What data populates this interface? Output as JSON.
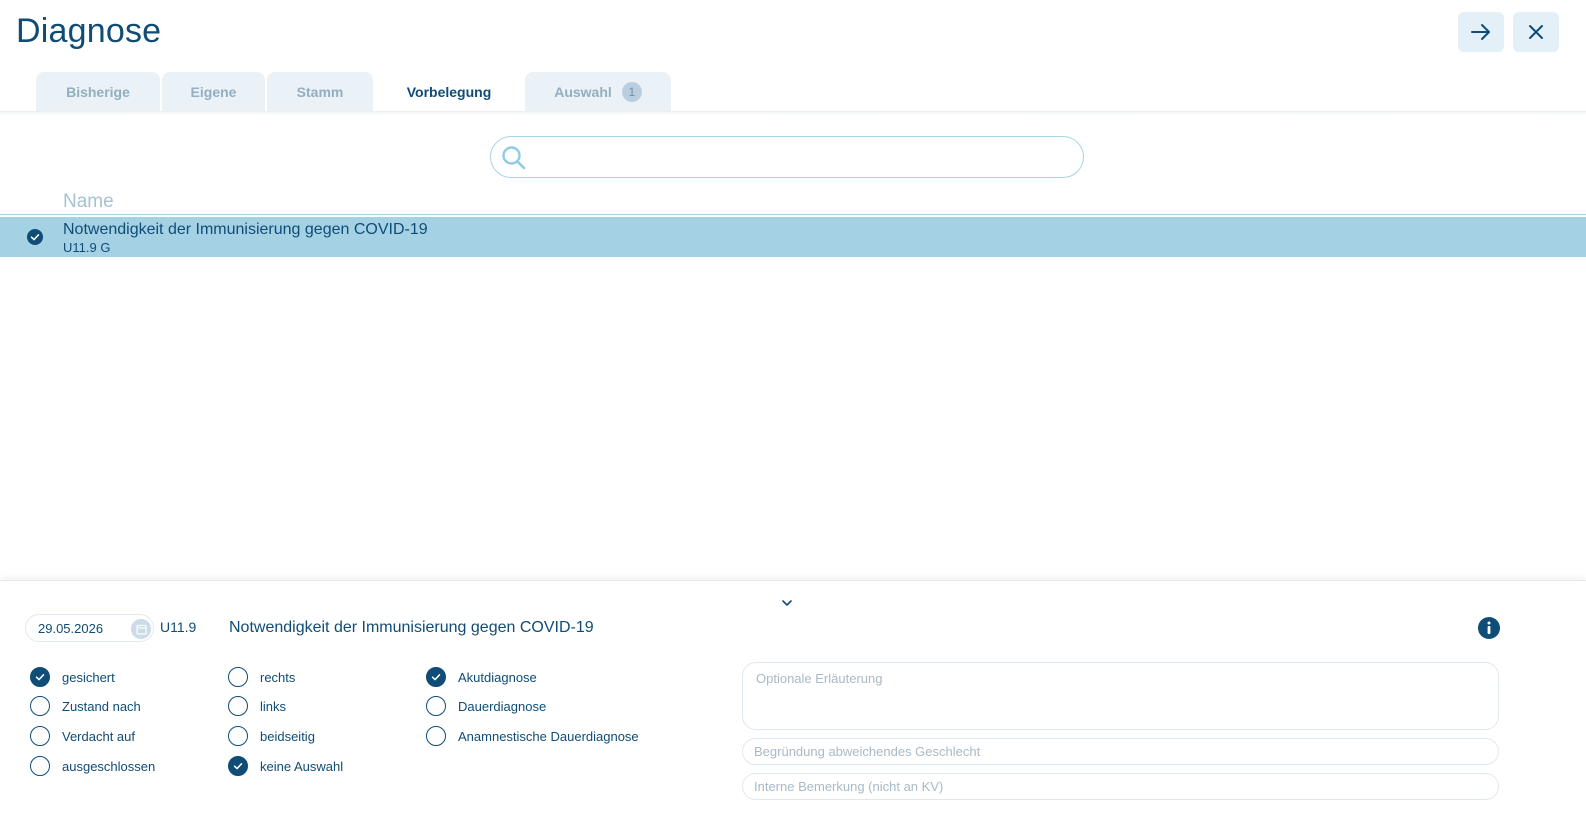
{
  "window": {
    "title": "Diagnose"
  },
  "tabs": [
    {
      "label": "Bisherige",
      "active": false
    },
    {
      "label": "Eigene",
      "active": false
    },
    {
      "label": "Stamm",
      "active": false
    },
    {
      "label": "Vorbelegung",
      "active": true
    },
    {
      "label": "Auswahl",
      "active": false,
      "badge": "1"
    }
  ],
  "search": {
    "value": "",
    "placeholder": ""
  },
  "list": {
    "header": "Name",
    "rows": [
      {
        "name": "Notwendigkeit der Immunisierung gegen COVID-19",
        "code": "U11.9 G",
        "selected": true
      }
    ]
  },
  "detail": {
    "date": "29.05.2026",
    "code": "U11.9",
    "title": "Notwendigkeit der Immunisierung gegen COVID-19",
    "certainty": [
      {
        "label": "gesichert",
        "checked": true
      },
      {
        "label": "Zustand nach",
        "checked": false
      },
      {
        "label": "Verdacht auf",
        "checked": false
      },
      {
        "label": "ausgeschlossen",
        "checked": false
      }
    ],
    "side": [
      {
        "label": "rechts",
        "checked": false
      },
      {
        "label": "links",
        "checked": false
      },
      {
        "label": "beidseitig",
        "checked": false
      },
      {
        "label": "keine Auswahl",
        "checked": true
      }
    ],
    "type": [
      {
        "label": "Akutdiagnose",
        "checked": true
      },
      {
        "label": "Dauerdiagnose",
        "checked": false
      },
      {
        "label": "Anamnestische Dauerdiagnose",
        "checked": false
      }
    ],
    "explanation_placeholder": "Optionale Erläuterung",
    "gender_reason_placeholder": "Begründung abweichendes Geschlecht",
    "internal_note_placeholder": "Interne Bemerkung (nicht an KV)"
  },
  "colors": {
    "primary": "#0f4c76",
    "row_selected": "#a5d1e5",
    "tab_bg": "#eaf2f7",
    "button_bg": "#e3f0f7"
  },
  "icons": {
    "next": "arrow-right-icon",
    "close": "close-icon",
    "search": "search-icon",
    "calendar": "calendar-icon",
    "info": "info-icon",
    "collapse": "chevron-down-icon"
  }
}
